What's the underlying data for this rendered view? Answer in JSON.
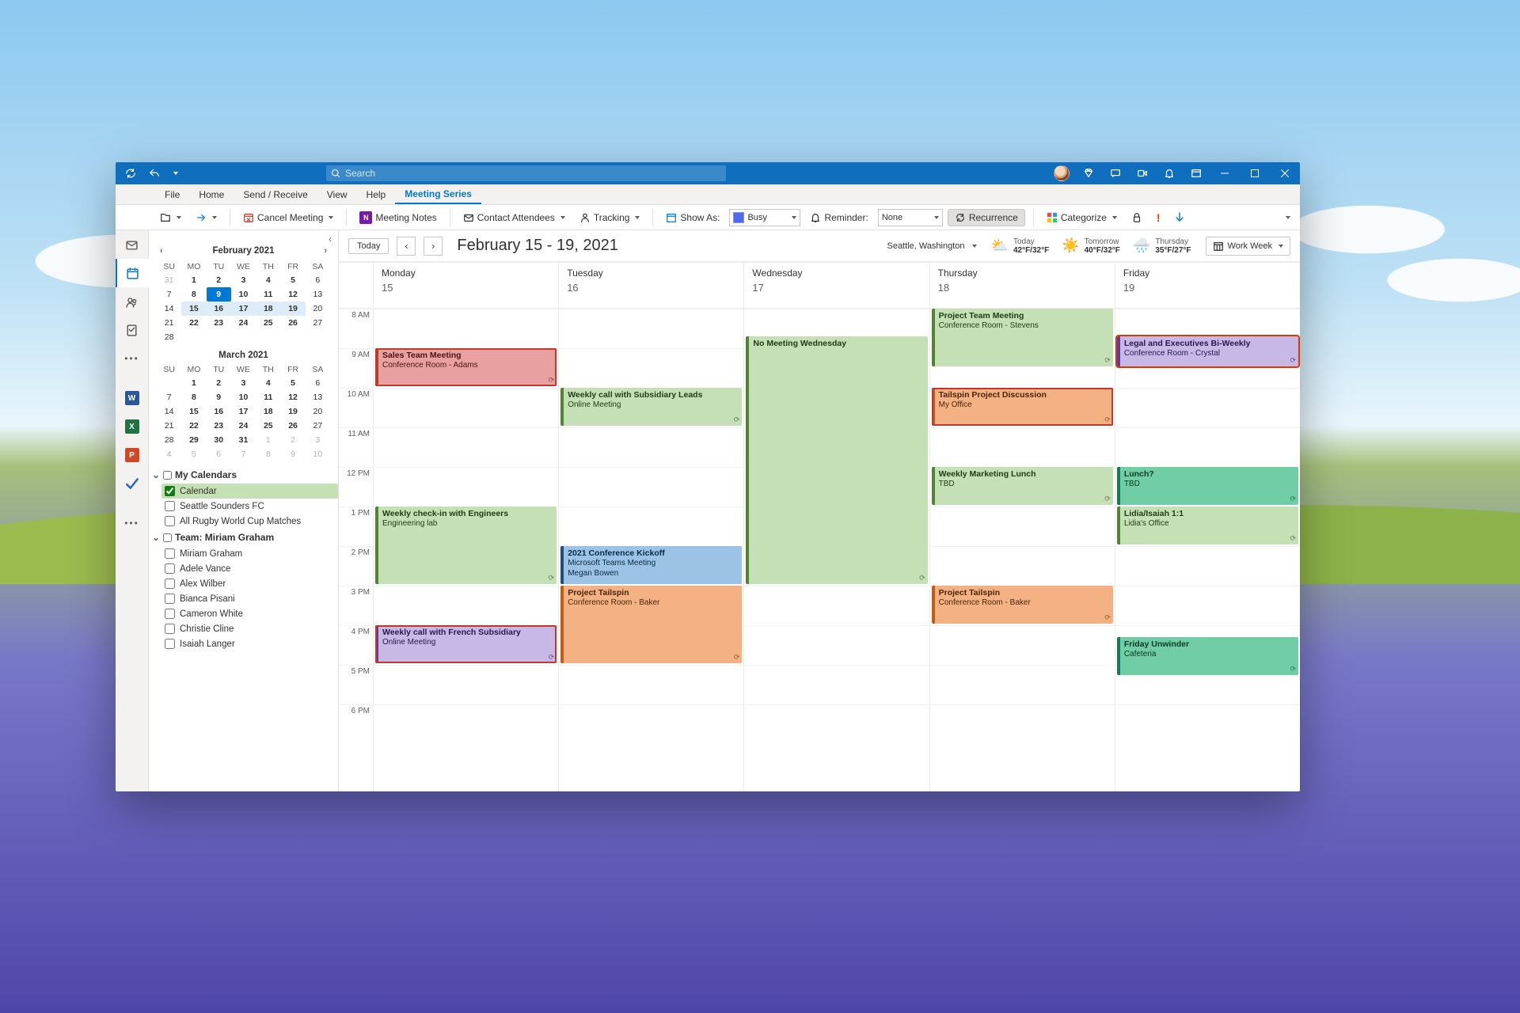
{
  "titlebar": {
    "search_placeholder": "Search"
  },
  "tabs": [
    "File",
    "Home",
    "Send / Receive",
    "View",
    "Help",
    "Meeting Series"
  ],
  "active_tab": 5,
  "ribbon": {
    "cancel": "Cancel Meeting",
    "notes": "Meeting Notes",
    "contact": "Contact Attendees",
    "tracking": "Tracking",
    "showas": "Show As:",
    "busy": "Busy",
    "reminder": "Reminder:",
    "none": "None",
    "recur": "Recurrence",
    "categorize": "Categorize"
  },
  "location": "Seattle, Washington",
  "forecast": [
    {
      "label": "Today",
      "temp": "42°F/32°F",
      "icon": "⛅"
    },
    {
      "label": "Tomorrow",
      "temp": "40°F/32°F",
      "icon": "☀️"
    },
    {
      "label": "Thursday",
      "temp": "35°F/27°F",
      "icon": "🌧️"
    }
  ],
  "viewmode": "Work Week",
  "toolbar": {
    "today": "Today",
    "range": "February 15 - 19, 2021"
  },
  "month1": {
    "title": "February 2021",
    "wk": [
      "SU",
      "MO",
      "TU",
      "WE",
      "TH",
      "FR",
      "SA"
    ],
    "cells": [
      {
        "n": "31",
        "c": "other"
      },
      {
        "n": "1",
        "c": "bold"
      },
      {
        "n": "2",
        "c": "bold"
      },
      {
        "n": "3",
        "c": "bold"
      },
      {
        "n": "4",
        "c": "bold"
      },
      {
        "n": "5",
        "c": "bold"
      },
      {
        "n": "6"
      },
      {
        "n": "7"
      },
      {
        "n": "8",
        "c": "bold"
      },
      {
        "n": "9",
        "c": "today"
      },
      {
        "n": "10",
        "c": "bold"
      },
      {
        "n": "11",
        "c": "bold"
      },
      {
        "n": "12",
        "c": "bold"
      },
      {
        "n": "13"
      },
      {
        "n": "14"
      },
      {
        "n": "15",
        "c": "sel bold"
      },
      {
        "n": "16",
        "c": "sel bold"
      },
      {
        "n": "17",
        "c": "sel bold"
      },
      {
        "n": "18",
        "c": "sel bold"
      },
      {
        "n": "19",
        "c": "sel bold"
      },
      {
        "n": "20"
      },
      {
        "n": "21"
      },
      {
        "n": "22",
        "c": "bold"
      },
      {
        "n": "23",
        "c": "bold"
      },
      {
        "n": "24",
        "c": "bold"
      },
      {
        "n": "25",
        "c": "bold"
      },
      {
        "n": "26",
        "c": "bold"
      },
      {
        "n": "27"
      },
      {
        "n": "28"
      }
    ]
  },
  "month2": {
    "title": "March 2021",
    "wk": [
      "SU",
      "MO",
      "TU",
      "WE",
      "TH",
      "FR",
      "SA"
    ],
    "cells": [
      {
        "n": ""
      },
      {
        "n": "1",
        "c": "bold"
      },
      {
        "n": "2",
        "c": "bold"
      },
      {
        "n": "3",
        "c": "bold"
      },
      {
        "n": "4",
        "c": "bold"
      },
      {
        "n": "5",
        "c": "bold"
      },
      {
        "n": "6"
      },
      {
        "n": "7"
      },
      {
        "n": "8",
        "c": "bold"
      },
      {
        "n": "9",
        "c": "bold"
      },
      {
        "n": "10",
        "c": "bold"
      },
      {
        "n": "11",
        "c": "bold"
      },
      {
        "n": "12",
        "c": "bold"
      },
      {
        "n": "13"
      },
      {
        "n": "14"
      },
      {
        "n": "15",
        "c": "bold"
      },
      {
        "n": "16",
        "c": "bold"
      },
      {
        "n": "17",
        "c": "bold"
      },
      {
        "n": "18",
        "c": "bold"
      },
      {
        "n": "19",
        "c": "bold"
      },
      {
        "n": "20"
      },
      {
        "n": "21"
      },
      {
        "n": "22",
        "c": "bold"
      },
      {
        "n": "23",
        "c": "bold"
      },
      {
        "n": "24",
        "c": "bold"
      },
      {
        "n": "25",
        "c": "bold"
      },
      {
        "n": "26",
        "c": "bold"
      },
      {
        "n": "27"
      },
      {
        "n": "28"
      },
      {
        "n": "29",
        "c": "bold"
      },
      {
        "n": "30",
        "c": "bold"
      },
      {
        "n": "31",
        "c": "bold"
      },
      {
        "n": "1",
        "c": "other"
      },
      {
        "n": "2",
        "c": "other"
      },
      {
        "n": "3",
        "c": "other"
      },
      {
        "n": "4",
        "c": "other"
      },
      {
        "n": "5",
        "c": "other"
      },
      {
        "n": "6",
        "c": "other"
      },
      {
        "n": "7",
        "c": "other"
      },
      {
        "n": "8",
        "c": "other"
      },
      {
        "n": "9",
        "c": "other"
      },
      {
        "n": "10",
        "c": "other"
      }
    ]
  },
  "calgroups": [
    {
      "name": "My Calendars",
      "items": [
        {
          "label": "Calendar",
          "checked": true,
          "active": true
        },
        {
          "label": "Seattle Sounders FC",
          "checked": false
        },
        {
          "label": "All Rugby World Cup Matches",
          "checked": false
        }
      ]
    },
    {
      "name": "Team: Miriam Graham",
      "items": [
        {
          "label": "Miriam Graham"
        },
        {
          "label": "Adele Vance"
        },
        {
          "label": "Alex Wilber"
        },
        {
          "label": "Bianca Pisani"
        },
        {
          "label": "Cameron White"
        },
        {
          "label": "Christie Cline"
        },
        {
          "label": "Isaiah Langer"
        }
      ]
    }
  ],
  "hours": [
    "8 AM",
    "9 AM",
    "10 AM",
    "11 AM",
    "12 PM",
    "1 PM",
    "2 PM",
    "3 PM",
    "4 PM",
    "5 PM",
    "6 PM"
  ],
  "columns": [
    {
      "dow": "Monday",
      "dom": "15",
      "events": [
        {
          "title": "Sales Team Meeting",
          "loc": "Conference Room - Adams",
          "start": 9,
          "end": 10,
          "cls": "g-red",
          "recur": true,
          "sel": "sel-evt"
        },
        {
          "title": "Weekly check-in with Engineers",
          "loc": "Engineering lab",
          "start": 13,
          "end": 15,
          "cls": "g-green",
          "recur": true
        },
        {
          "title": "Weekly call with French Subsidiary",
          "loc": "Online Meeting",
          "start": 16,
          "end": 17,
          "cls": "g-purple",
          "recur": true,
          "sel": "sel-evt"
        }
      ]
    },
    {
      "dow": "Tuesday",
      "dom": "16",
      "events": [
        {
          "title": "Weekly call with Subsidiary Leads",
          "loc": "Online Meeting",
          "start": 10,
          "end": 11,
          "cls": "g-green",
          "recur": true
        },
        {
          "title": "2021 Conference Kickoff",
          "loc": "Microsoft Teams Meeting\nMegan Bowen",
          "start": 14,
          "end": 15,
          "cls": "g-blue"
        },
        {
          "title": "Project Tailspin",
          "loc": "Conference Room - Baker",
          "start": 15,
          "end": 17,
          "cls": "g-orange",
          "recur": true
        }
      ]
    },
    {
      "dow": "Wednesday",
      "dom": "17",
      "events": [
        {
          "title": "No Meeting Wednesday",
          "loc": "",
          "start": 8.7,
          "end": 15,
          "cls": "g-green",
          "recur": true
        }
      ]
    },
    {
      "dow": "Thursday",
      "dom": "18",
      "events": [
        {
          "title": "Project Team Meeting",
          "loc": "Conference Room - Stevens",
          "start": 8,
          "end": 9.5,
          "cls": "g-green",
          "recur": true
        },
        {
          "title": "Tailspin Project Discussion",
          "loc": "My Office",
          "start": 10,
          "end": 11,
          "cls": "g-orange",
          "sel": "sel-evt",
          "recur": true
        },
        {
          "title": "Weekly Marketing Lunch",
          "loc": "TBD",
          "start": 12,
          "end": 13,
          "cls": "g-green",
          "recur": true
        },
        {
          "title": "Project Tailspin",
          "loc": "Conference Room - Baker",
          "start": 15,
          "end": 16,
          "cls": "g-orange",
          "recur": true
        }
      ]
    },
    {
      "dow": "Friday",
      "dom": "19",
      "events": [
        {
          "title": "Legal and Executives Bi-Weekly",
          "loc": "Conference Room - Crystal",
          "start": 8.7,
          "end": 9.5,
          "cls": "g-purple",
          "recur": true,
          "sel": "sel-evt2"
        },
        {
          "title": "Lunch?",
          "loc": "TBD",
          "start": 12,
          "end": 13,
          "cls": "g-teal",
          "recur": true
        },
        {
          "title": "Lidia/Isaiah 1:1",
          "loc": "Lidia's Office",
          "start": 13,
          "end": 14,
          "cls": "g-green",
          "recur": true
        },
        {
          "title": "Friday Unwinder",
          "loc": "Cafeteria",
          "start": 16.3,
          "end": 17.3,
          "cls": "g-teal",
          "recur": true
        }
      ]
    }
  ]
}
